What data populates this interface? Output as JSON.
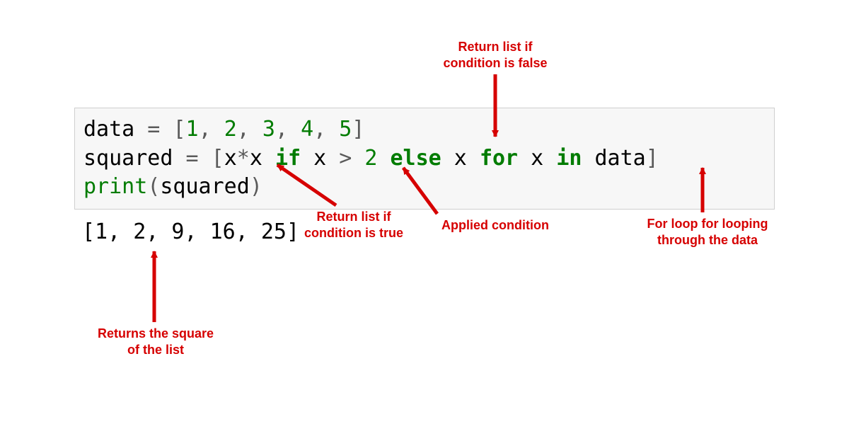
{
  "code": {
    "line1": {
      "data_id": "data",
      "eq": " = ",
      "open": "[",
      "n1": "1",
      "c1": ", ",
      "n2": "2",
      "c2": ", ",
      "n3": "3",
      "c3": ", ",
      "n4": "4",
      "c4": ", ",
      "n5": "5",
      "close": "]"
    },
    "line2": {
      "sq_id": "squared",
      "eq": " = ",
      "open": "[",
      "xx": "x",
      "star": "*",
      "xx2": "x",
      "sp1": " ",
      "if_kw": "if",
      "cond_x": " x ",
      "gt": ">",
      "sp2": " ",
      "two": "2",
      "sp3": " ",
      "else_kw": "else",
      "sp4": " x ",
      "for_kw": "for",
      "sp5": " x ",
      "in_kw": "in",
      "sp6": " data",
      "close": "]"
    },
    "line3": {
      "print_fn": "print",
      "open": "(",
      "arg": "squared",
      "close": ")"
    }
  },
  "output_text": "[1, 2, 9, 16, 25]",
  "annotations": {
    "return_false": "Return list if\ncondition is false",
    "return_true": "Return list if\ncondition is true",
    "applied_cond": "Applied condition",
    "for_loop": "For loop for looping\nthrough the data",
    "returns_square": "Returns the square\nof the list"
  },
  "colors": {
    "annotation": "#d60000",
    "keyword": "#007c00"
  }
}
